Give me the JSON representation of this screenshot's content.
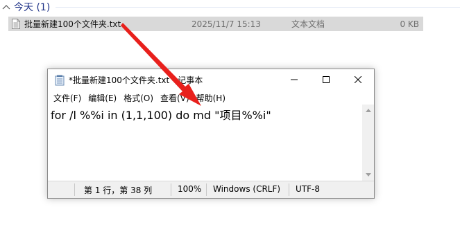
{
  "group": {
    "label": "今天 (1)"
  },
  "file": {
    "name": "批量新建100个文件夹.txt",
    "date": "2025/11/7 15:13",
    "type": "文本文档",
    "size": "0 KB",
    "icon": "text-file-icon"
  },
  "notepad": {
    "title": "*批量新建100个文件夹.txt - 记事本",
    "menu": [
      "文件(F)",
      "编辑(E)",
      "格式(O)",
      "查看(V)",
      "帮助(H)"
    ],
    "content": "for /l %%i in (1,1,100) do md \"项目%%i\"",
    "status": {
      "position": "第 1 行，第 38 列",
      "zoom": "100%",
      "line_ending": "Windows (CRLF)",
      "encoding": "UTF-8"
    },
    "controls": [
      "minimize-icon",
      "maximize-icon",
      "close-icon"
    ]
  },
  "colors": {
    "group_header": "#1e3287",
    "selection": "#d9d9d9",
    "arrow": "#e8201c"
  }
}
